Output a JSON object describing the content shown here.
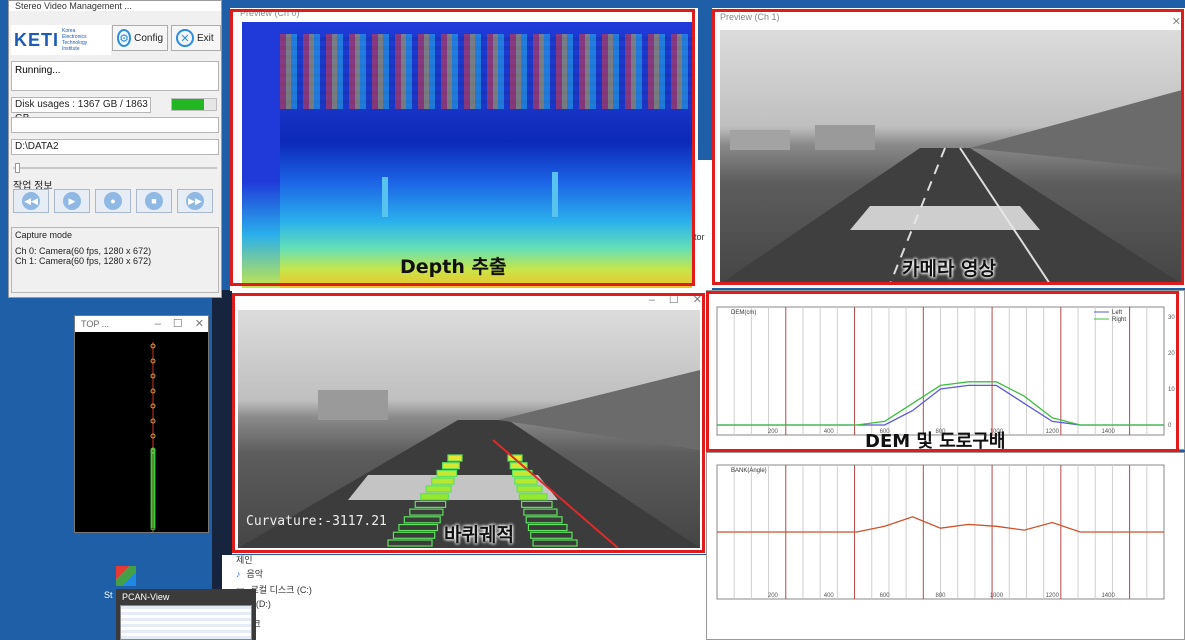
{
  "svm": {
    "title": "Stereo Video Management ...",
    "logo_text": "KETI",
    "logo_sub": [
      "Korea",
      "Electronics",
      "Technology",
      "Institute"
    ],
    "config_label": "Config",
    "exit_label": "Exit",
    "status": "Running...",
    "disk_usage": "Disk usages : 1367 GB / 1863 GB",
    "disk_fill_fraction": 0.73,
    "path": "D:\\DATA2",
    "work_info_label": "작업 정보",
    "capture_mode_label": "Capture mode",
    "capture_lines": [
      "Ch 0: Camera(60 fps, 1280 x 672)",
      "Ch 1: Camera(60 fps, 1280 x 672)"
    ]
  },
  "depth": {
    "title": "Preview (Ch 0)",
    "label": "Depth 추출"
  },
  "camera": {
    "title": "Preview (Ch 1)",
    "label": "카메라 영상"
  },
  "curvature": {
    "title": "",
    "curvature_text": "Curvature:-3117.21",
    "label": "바퀴궤적"
  },
  "dem_chart": {
    "label": "DEM 및 도로구배",
    "legend": [
      "Left",
      "Right"
    ]
  },
  "topwin": {
    "title": "TOP ..."
  },
  "explorer": {
    "items": [
      "음악",
      "로컬 디스크 (C:)",
      "AVE (D:)",
      "트워크"
    ],
    "partial_item": "제인"
  },
  "desktop": {
    "icon_label": "St"
  },
  "pcan": {
    "title": "PCAN-View"
  },
  "hidden_text": {
    "tor": "tor"
  },
  "chart_data": [
    {
      "type": "line",
      "title": "DEM(cm)",
      "xlabel": "",
      "ylabel": "",
      "x_ticks": [
        200,
        400,
        600,
        800,
        1000,
        1200,
        1400
      ],
      "y_ticks": [
        0,
        10,
        20,
        30
      ],
      "ylim": [
        0,
        30
      ],
      "xlim": [
        0,
        1600
      ],
      "legend_placement": "top-right",
      "series": [
        {
          "name": "Left",
          "color": "#5b5bd6",
          "x": [
            0,
            500,
            600,
            700,
            800,
            900,
            1000,
            1100,
            1200,
            1300,
            1600
          ],
          "y": [
            0,
            0,
            0,
            4,
            10,
            11,
            11,
            6,
            1,
            0,
            0
          ]
        },
        {
          "name": "Right",
          "color": "#3fbf3f",
          "x": [
            0,
            500,
            600,
            700,
            800,
            900,
            1000,
            1100,
            1200,
            1300,
            1600
          ],
          "y": [
            0,
            0,
            1,
            6,
            11,
            12,
            12,
            8,
            2,
            0,
            0
          ]
        }
      ]
    },
    {
      "type": "line",
      "title": "BANK(Angle)",
      "xlabel": "",
      "ylabel": "",
      "x_ticks": [
        200,
        400,
        600,
        800,
        1000,
        1200,
        1400
      ],
      "xlim": [
        0,
        1600
      ],
      "series": [
        {
          "color": "#d0502a",
          "x": [
            0,
            500,
            600,
            700,
            800,
            900,
            1000,
            1100,
            1200,
            1300,
            1600
          ],
          "y": [
            0,
            0,
            0.3,
            0.8,
            0.2,
            0.4,
            0.3,
            0.1,
            0.5,
            0,
            0
          ]
        }
      ]
    }
  ],
  "colors": {
    "highlight_frame": "#e01b1b",
    "desktop": "#1f5fa8"
  }
}
